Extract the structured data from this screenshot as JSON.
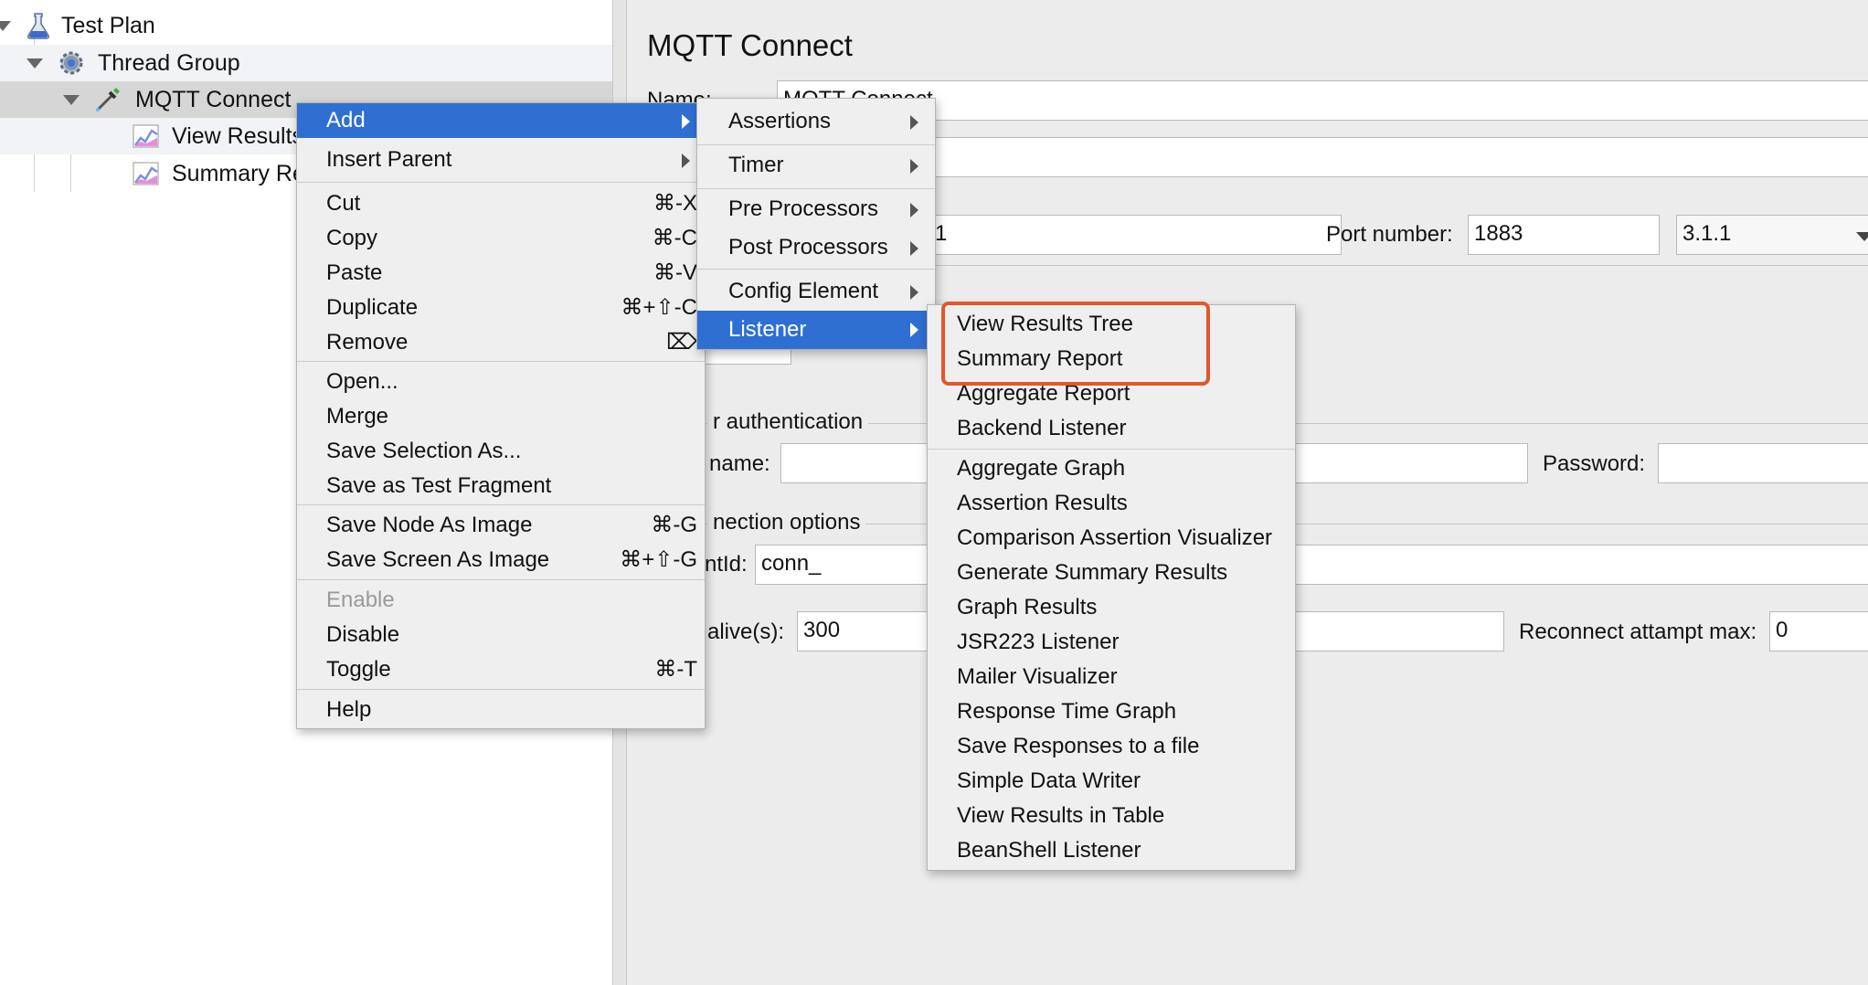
{
  "tree": {
    "items": [
      {
        "label": "Test Plan",
        "icon": "flask-icon"
      },
      {
        "label": "Thread Group",
        "icon": "gear-icon"
      },
      {
        "label": "MQTT Connect",
        "icon": "dropper-icon"
      },
      {
        "label": "View Results",
        "icon": "graph-icon"
      },
      {
        "label": "Summary Re",
        "icon": "graph-icon"
      }
    ]
  },
  "panel": {
    "title": "MQTT Connect",
    "name_label": "Name:",
    "name_value": "MQTT Connect",
    "server_value_fragment": "1",
    "port_label": "Port number:",
    "port_value": "1883",
    "version_value": "3.1.1",
    "auth_section": "r authentication",
    "username_label": "name:",
    "password_label": "Password:",
    "conn_section": "nection options",
    "clientid_label": "ntId:",
    "clientid_value": "conn_",
    "keepalive_label": "alive(s):",
    "keepalive_value": "300",
    "reconnect_label": "Reconnect attampt max:",
    "reconnect_value": "0"
  },
  "context_menu": {
    "items": [
      {
        "label": "Add",
        "submenu": true,
        "highlighted": true
      },
      {
        "label": "Insert Parent",
        "submenu": true
      },
      {
        "label": "Cut",
        "shortcut": "⌘-X"
      },
      {
        "label": "Copy",
        "shortcut": "⌘-C"
      },
      {
        "label": "Paste",
        "shortcut": "⌘-V"
      },
      {
        "label": "Duplicate",
        "shortcut": "⌘+⇧-C"
      },
      {
        "label": "Remove",
        "shortcut": "⌦"
      },
      {
        "label": "Open..."
      },
      {
        "label": "Merge"
      },
      {
        "label": "Save Selection As..."
      },
      {
        "label": "Save as Test Fragment"
      },
      {
        "label": "Save Node As Image",
        "shortcut": "⌘-G"
      },
      {
        "label": "Save Screen As Image",
        "shortcut": "⌘+⇧-G"
      },
      {
        "label": "Enable",
        "disabled": true
      },
      {
        "label": "Disable"
      },
      {
        "label": "Toggle",
        "shortcut": "⌘-T"
      },
      {
        "label": "Help"
      }
    ]
  },
  "add_submenu": {
    "items": [
      {
        "label": "Assertions"
      },
      {
        "label": "Timer"
      },
      {
        "label": "Pre Processors"
      },
      {
        "label": "Post Processors"
      },
      {
        "label": "Config Element"
      },
      {
        "label": "Listener",
        "highlighted": true
      }
    ]
  },
  "listener_submenu": {
    "items": [
      "View Results Tree",
      "Summary Report",
      "Aggregate Report",
      "Backend Listener",
      "Aggregate Graph",
      "Assertion Results",
      "Comparison Assertion Visualizer",
      "Generate Summary Results",
      "Graph Results",
      "JSR223 Listener",
      "Mailer Visualizer",
      "Response Time Graph",
      "Save Responses to a file",
      "Simple Data Writer",
      "View Results in Table",
      "BeanShell Listener"
    ]
  },
  "colors": {
    "menu_highlight": "#2f6fd1",
    "annotation_box": "#e2572c"
  }
}
